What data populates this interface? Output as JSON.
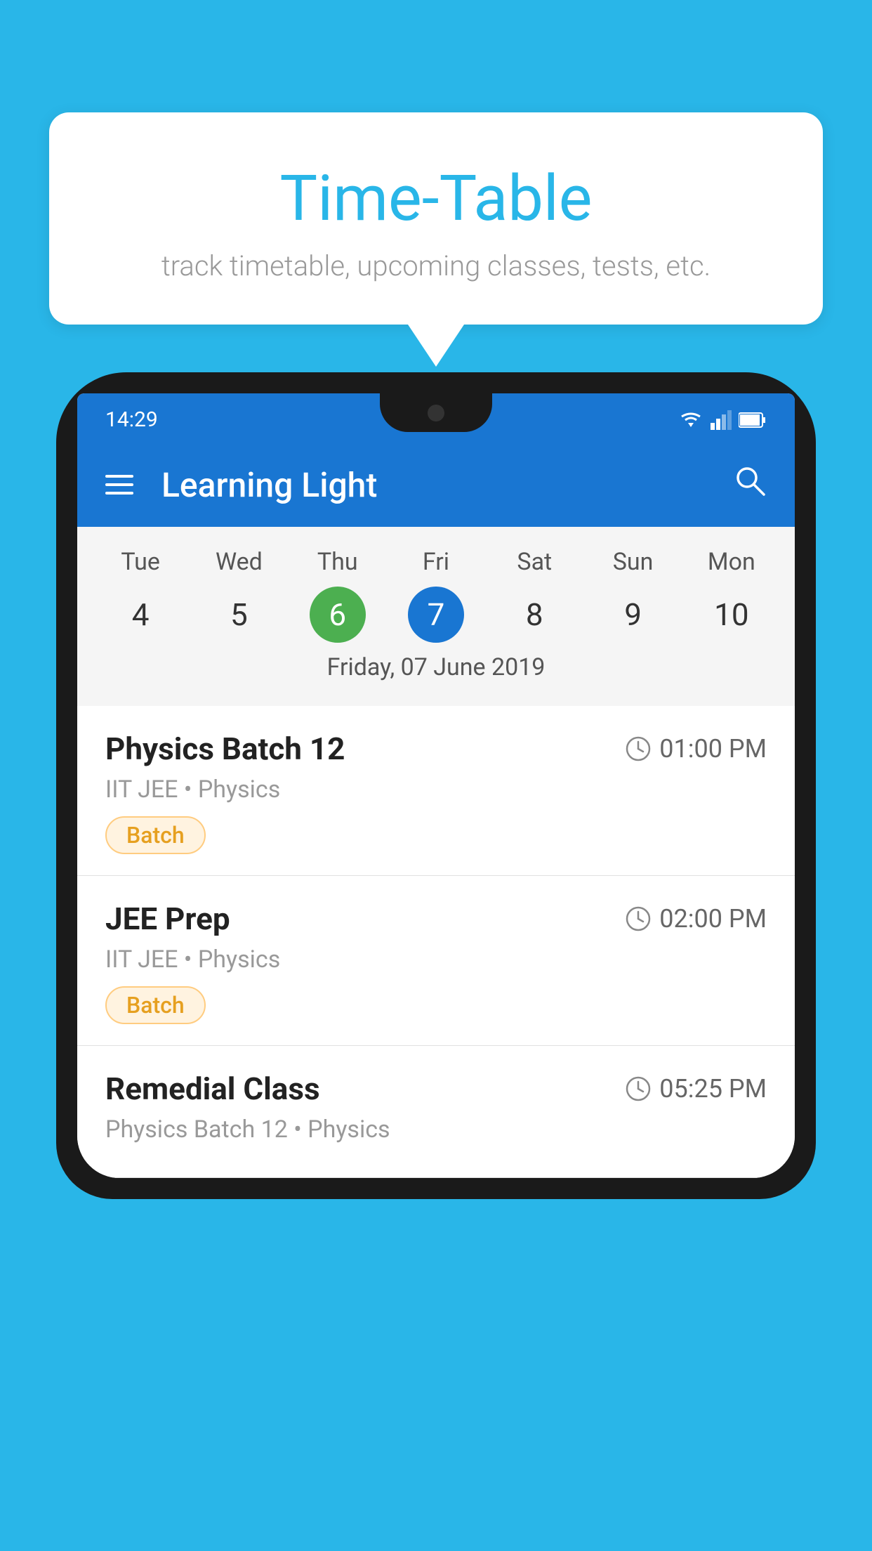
{
  "background_color": "#29b6e8",
  "bubble": {
    "title": "Time-Table",
    "subtitle": "track timetable, upcoming classes, tests, etc."
  },
  "status_bar": {
    "time": "14:29"
  },
  "app_bar": {
    "title": "Learning Light"
  },
  "calendar": {
    "days": [
      "Tue",
      "Wed",
      "Thu",
      "Fri",
      "Sat",
      "Sun",
      "Mon"
    ],
    "dates": [
      "4",
      "5",
      "6",
      "7",
      "8",
      "9",
      "10"
    ],
    "today_index": 2,
    "selected_index": 3,
    "selected_label": "Friday, 07 June 2019"
  },
  "schedule": [
    {
      "title": "Physics Batch 12",
      "time": "01:00 PM",
      "meta": "IIT JEE • Physics",
      "badge": "Batch"
    },
    {
      "title": "JEE Prep",
      "time": "02:00 PM",
      "meta": "IIT JEE • Physics",
      "badge": "Batch"
    },
    {
      "title": "Remedial Class",
      "time": "05:25 PM",
      "meta": "Physics Batch 12 • Physics",
      "badge": null
    }
  ],
  "icons": {
    "hamburger": "hamburger-menu",
    "search": "search",
    "clock": "⏱"
  }
}
